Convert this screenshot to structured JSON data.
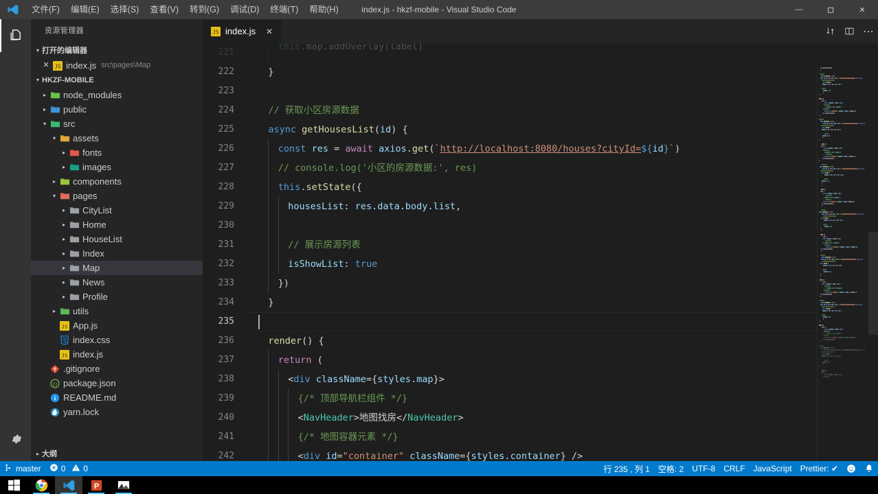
{
  "titlebar": {
    "logo_icon": "vscode-logo",
    "menus": [
      {
        "label": "文件(F)",
        "name": "menu-file"
      },
      {
        "label": "编辑(E)",
        "name": "menu-edit"
      },
      {
        "label": "选择(S)",
        "name": "menu-selection"
      },
      {
        "label": "查看(V)",
        "name": "menu-view"
      },
      {
        "label": "转到(G)",
        "name": "menu-goto"
      },
      {
        "label": "调试(D)",
        "name": "menu-debug"
      },
      {
        "label": "终端(T)",
        "name": "menu-terminal"
      },
      {
        "label": "帮助(H)",
        "name": "menu-help"
      }
    ],
    "window_title": "index.js - hkzf-mobile - Visual Studio Code",
    "minimize": "—",
    "maximize": "❐",
    "close": "✕"
  },
  "activitybar": {
    "explorer_icon": "files-explorer-icon",
    "settings_icon": "gear-icon"
  },
  "sidebar": {
    "title": "资源管理器",
    "open_editors": {
      "label": "打开的编辑器",
      "items": [
        {
          "name": "index.js",
          "path": "src\\pages\\Map",
          "icon": "js-file-icon",
          "close": "✕"
        }
      ]
    },
    "project": {
      "label": "HKZF-MOBILE",
      "tree": [
        {
          "label": "node_modules",
          "indent": 1,
          "icon": "folder-green-icon",
          "twisty": "collapsed",
          "selected": false
        },
        {
          "label": "public",
          "indent": 1,
          "icon": "folder-blue-icon",
          "twisty": "collapsed",
          "selected": false
        },
        {
          "label": "src",
          "indent": 1,
          "icon": "folder-src-icon",
          "twisty": "expanded",
          "selected": false
        },
        {
          "label": "assets",
          "indent": 2,
          "icon": "folder-yellow-icon",
          "twisty": "expanded",
          "selected": false
        },
        {
          "label": "fonts",
          "indent": 3,
          "icon": "folder-red-icon",
          "twisty": "collapsed",
          "selected": false
        },
        {
          "label": "images",
          "indent": 3,
          "icon": "folder-teal-icon",
          "twisty": "collapsed",
          "selected": false
        },
        {
          "label": "components",
          "indent": 2,
          "icon": "folder-lime-icon",
          "twisty": "collapsed",
          "selected": false
        },
        {
          "label": "pages",
          "indent": 2,
          "icon": "folder-salmon-icon",
          "twisty": "expanded",
          "selected": false
        },
        {
          "label": "CityList",
          "indent": 3,
          "icon": "folder-icon",
          "twisty": "collapsed",
          "selected": false
        },
        {
          "label": "Home",
          "indent": 3,
          "icon": "folder-icon",
          "twisty": "collapsed",
          "selected": false
        },
        {
          "label": "HouseList",
          "indent": 3,
          "icon": "folder-icon",
          "twisty": "collapsed",
          "selected": false
        },
        {
          "label": "Index",
          "indent": 3,
          "icon": "folder-icon",
          "twisty": "collapsed",
          "selected": false
        },
        {
          "label": "Map",
          "indent": 3,
          "icon": "folder-icon",
          "twisty": "collapsed",
          "selected": true
        },
        {
          "label": "News",
          "indent": 3,
          "icon": "folder-icon",
          "twisty": "collapsed",
          "selected": false
        },
        {
          "label": "Profile",
          "indent": 3,
          "icon": "folder-icon",
          "twisty": "collapsed",
          "selected": false
        },
        {
          "label": "utils",
          "indent": 2,
          "icon": "folder-green2-icon",
          "twisty": "collapsed",
          "selected": false
        },
        {
          "label": "App.js",
          "indent": 2,
          "icon": "js-file-icon",
          "twisty": "none",
          "selected": false
        },
        {
          "label": "index.css",
          "indent": 2,
          "icon": "css-file-icon",
          "twisty": "none",
          "selected": false
        },
        {
          "label": "index.js",
          "indent": 2,
          "icon": "js-file-icon",
          "twisty": "none",
          "selected": false
        },
        {
          "label": ".gitignore",
          "indent": 1,
          "icon": "git-file-icon",
          "twisty": "none",
          "selected": false
        },
        {
          "label": "package.json",
          "indent": 1,
          "icon": "npm-file-icon",
          "twisty": "none",
          "selected": false
        },
        {
          "label": "README.md",
          "indent": 1,
          "icon": "markdown-file-icon",
          "twisty": "none",
          "selected": false
        },
        {
          "label": "yarn.lock",
          "indent": 1,
          "icon": "yarn-file-icon",
          "twisty": "none",
          "selected": false
        }
      ]
    },
    "outline_label": "大纲"
  },
  "editor": {
    "tabs": [
      {
        "label": "index.js",
        "icon": "js-file-icon",
        "close": "✕",
        "active": true
      }
    ],
    "actions": [
      {
        "name": "split-editor-icon",
        "glyph": "⧉"
      },
      {
        "name": "toggle-panel-icon",
        "glyph": "◫"
      },
      {
        "name": "more-actions-icon",
        "glyph": "⋯"
      }
    ],
    "first_line_number": 221,
    "active_line": 235,
    "lines": [
      {
        "n": 221,
        "partial": true,
        "indent": 2,
        "tokens": [
          {
            "t": "this",
            "c": "tk-kw"
          },
          {
            "t": ".map.addOverlay(label)",
            "c": "tk-plain"
          }
        ]
      },
      {
        "n": 222,
        "indent": 1,
        "tokens": [
          {
            "t": "}",
            "c": "tk-plain"
          }
        ]
      },
      {
        "n": 223,
        "indent": 0,
        "tokens": []
      },
      {
        "n": 224,
        "indent": 1,
        "tokens": [
          {
            "t": "// 获取小区房源数据",
            "c": "tk-cmt"
          }
        ]
      },
      {
        "n": 225,
        "indent": 1,
        "tokens": [
          {
            "t": "async ",
            "c": "tk-kw"
          },
          {
            "t": "getHousesList",
            "c": "tk-fn"
          },
          {
            "t": "(",
            "c": "tk-plain"
          },
          {
            "t": "id",
            "c": "tk-var"
          },
          {
            "t": ") {",
            "c": "tk-plain"
          }
        ]
      },
      {
        "n": 226,
        "indent": 2,
        "tokens": [
          {
            "t": "const ",
            "c": "tk-kw"
          },
          {
            "t": "res",
            "c": "tk-var"
          },
          {
            "t": " = ",
            "c": "tk-plain"
          },
          {
            "t": "await ",
            "c": "tk-ctrl"
          },
          {
            "t": "axios",
            "c": "tk-var"
          },
          {
            "t": ".",
            "c": "tk-plain"
          },
          {
            "t": "get",
            "c": "tk-fn"
          },
          {
            "t": "(",
            "c": "tk-plain"
          },
          {
            "t": "`",
            "c": "tk-str"
          },
          {
            "t": "http://localhost:8080/houses?cityId=",
            "c": "tk-link"
          },
          {
            "t": "${",
            "c": "tk-tmpl"
          },
          {
            "t": "id",
            "c": "tk-var"
          },
          {
            "t": "}",
            "c": "tk-tmpl"
          },
          {
            "t": "`",
            "c": "tk-str"
          },
          {
            "t": ")",
            "c": "tk-plain"
          }
        ]
      },
      {
        "n": 227,
        "indent": 2,
        "tokens": [
          {
            "t": "// console.log('小区的房源数据:', res)",
            "c": "tk-cmt"
          }
        ]
      },
      {
        "n": 228,
        "indent": 2,
        "tokens": [
          {
            "t": "this",
            "c": "tk-kw"
          },
          {
            "t": ".",
            "c": "tk-plain"
          },
          {
            "t": "setState",
            "c": "tk-fn"
          },
          {
            "t": "({",
            "c": "tk-plain"
          }
        ]
      },
      {
        "n": 229,
        "indent": 3,
        "tokens": [
          {
            "t": "housesList",
            "c": "tk-var"
          },
          {
            "t": ": ",
            "c": "tk-plain"
          },
          {
            "t": "res",
            "c": "tk-var"
          },
          {
            "t": ".",
            "c": "tk-plain"
          },
          {
            "t": "data",
            "c": "tk-prop"
          },
          {
            "t": ".",
            "c": "tk-plain"
          },
          {
            "t": "body",
            "c": "tk-prop"
          },
          {
            "t": ".",
            "c": "tk-plain"
          },
          {
            "t": "list",
            "c": "tk-prop"
          },
          {
            "t": ",",
            "c": "tk-plain"
          }
        ]
      },
      {
        "n": 230,
        "indent": 3,
        "tokens": []
      },
      {
        "n": 231,
        "indent": 3,
        "tokens": [
          {
            "t": "// 展示房源列表",
            "c": "tk-cmt"
          }
        ]
      },
      {
        "n": 232,
        "indent": 3,
        "tokens": [
          {
            "t": "isShowList",
            "c": "tk-var"
          },
          {
            "t": ": ",
            "c": "tk-plain"
          },
          {
            "t": "true",
            "c": "tk-kw"
          }
        ]
      },
      {
        "n": 233,
        "indent": 2,
        "tokens": [
          {
            "t": "})",
            "c": "tk-plain"
          }
        ]
      },
      {
        "n": 234,
        "indent": 1,
        "tokens": [
          {
            "t": "}",
            "c": "tk-plain"
          }
        ]
      },
      {
        "n": 235,
        "indent": 0,
        "tokens": []
      },
      {
        "n": 236,
        "indent": 1,
        "tokens": [
          {
            "t": "render",
            "c": "tk-fn"
          },
          {
            "t": "() {",
            "c": "tk-plain"
          }
        ]
      },
      {
        "n": 237,
        "indent": 2,
        "tokens": [
          {
            "t": "return ",
            "c": "tk-ctrl"
          },
          {
            "t": "(",
            "c": "tk-plain"
          }
        ]
      },
      {
        "n": 238,
        "indent": 3,
        "tokens": [
          {
            "t": "<",
            "c": "tk-punct"
          },
          {
            "t": "div",
            "c": "tk-kw"
          },
          {
            "t": " ",
            "c": "tk-plain"
          },
          {
            "t": "className",
            "c": "tk-attr"
          },
          {
            "t": "={",
            "c": "tk-plain"
          },
          {
            "t": "styles",
            "c": "tk-var"
          },
          {
            "t": ".",
            "c": "tk-plain"
          },
          {
            "t": "map",
            "c": "tk-prop"
          },
          {
            "t": "}>",
            "c": "tk-plain"
          }
        ]
      },
      {
        "n": 239,
        "indent": 4,
        "tokens": [
          {
            "t": "{/* 顶部导航栏组件 */}",
            "c": "tk-cmt"
          }
        ]
      },
      {
        "n": 240,
        "indent": 4,
        "tokens": [
          {
            "t": "<",
            "c": "tk-punct"
          },
          {
            "t": "NavHeader",
            "c": "tk-tag"
          },
          {
            "t": ">",
            "c": "tk-punct"
          },
          {
            "t": "地图找房",
            "c": "tk-plain"
          },
          {
            "t": "</",
            "c": "tk-punct"
          },
          {
            "t": "NavHeader",
            "c": "tk-tag"
          },
          {
            "t": ">",
            "c": "tk-punct"
          }
        ]
      },
      {
        "n": 241,
        "indent": 4,
        "tokens": [
          {
            "t": "{/* 地图容器元素 */}",
            "c": "tk-cmt"
          }
        ]
      },
      {
        "n": 242,
        "indent": 4,
        "tokens": [
          {
            "t": "<",
            "c": "tk-punct"
          },
          {
            "t": "div",
            "c": "tk-kw"
          },
          {
            "t": " ",
            "c": "tk-plain"
          },
          {
            "t": "id",
            "c": "tk-attr"
          },
          {
            "t": "=",
            "c": "tk-plain"
          },
          {
            "t": "\"container\"",
            "c": "tk-str"
          },
          {
            "t": " ",
            "c": "tk-plain"
          },
          {
            "t": "className",
            "c": "tk-attr"
          },
          {
            "t": "={",
            "c": "tk-plain"
          },
          {
            "t": "styles",
            "c": "tk-var"
          },
          {
            "t": ".",
            "c": "tk-plain"
          },
          {
            "t": "container",
            "c": "tk-prop"
          },
          {
            "t": "} />",
            "c": "tk-plain"
          }
        ]
      }
    ]
  },
  "statusbar": {
    "branch_icon": "source-control-branch-icon",
    "branch": "master",
    "error_icon": "error-circle-icon",
    "errors": "0",
    "warning_icon": "warning-triangle-icon",
    "warnings": "0",
    "cursor_position": "行 235 , 列 1",
    "indentation": "空格: 2",
    "encoding": "UTF-8",
    "eol": "CRLF",
    "language": "JavaScript",
    "formatter": "Prettier: ✔",
    "feedback_icon": "smiley-icon",
    "bell_icon": "bell-icon",
    "accent_color": "#007acc"
  },
  "taskbar": {
    "items": [
      {
        "name": "start-button",
        "icon": "windows-logo-icon",
        "running": false,
        "active": false
      },
      {
        "name": "taskbar-chrome",
        "icon": "chrome-icon",
        "running": true,
        "active": false
      },
      {
        "name": "taskbar-vscode",
        "icon": "vscode-icon",
        "running": true,
        "active": true
      },
      {
        "name": "taskbar-powerpoint",
        "icon": "powerpoint-icon",
        "running": true,
        "active": false
      },
      {
        "name": "taskbar-photos",
        "icon": "photos-icon",
        "running": true,
        "active": false
      }
    ]
  }
}
